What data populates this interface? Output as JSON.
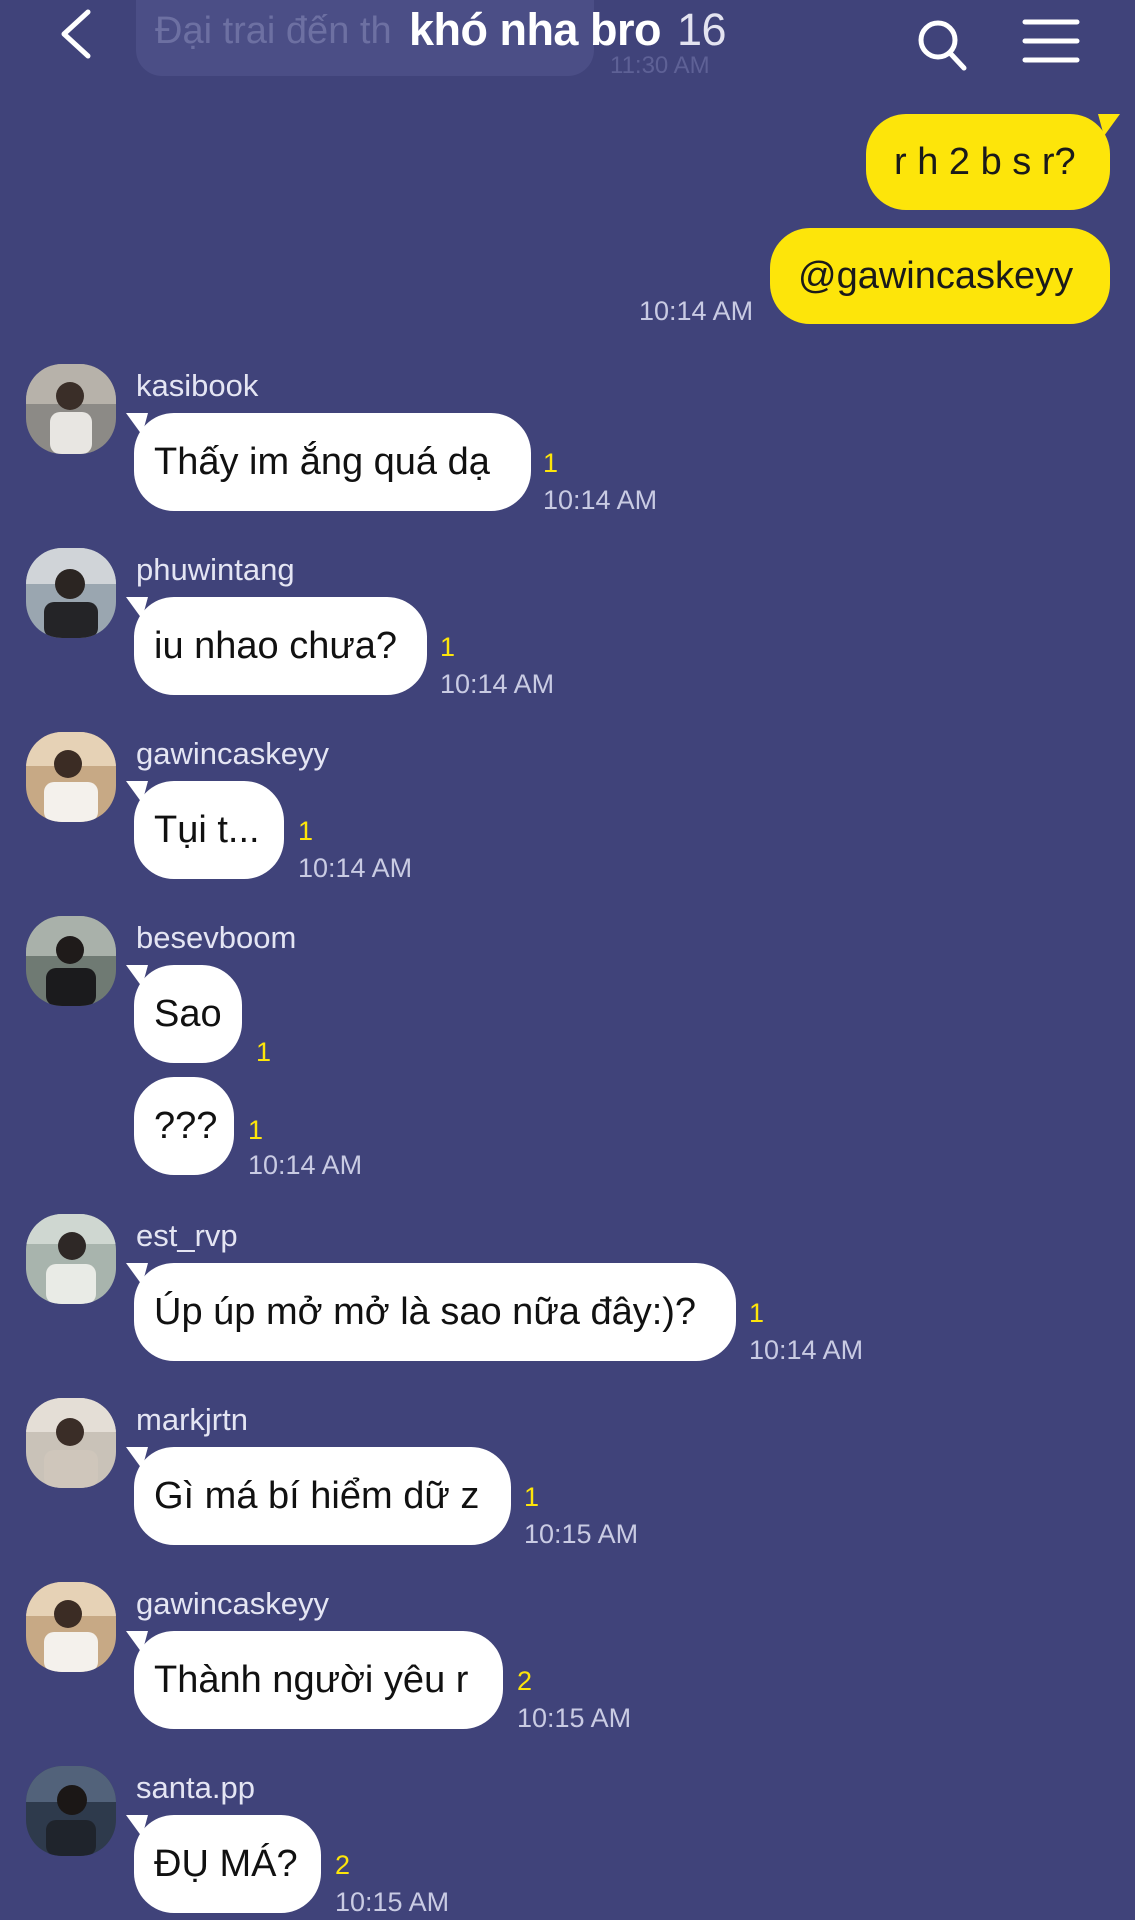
{
  "header": {
    "ghost_preview_text": "Đại trai đến th",
    "ghost_preview_time": "11:30 AM",
    "title": "khó nha bro",
    "member_count": "16"
  },
  "outgoing": [
    {
      "text": "r h 2 b s r?"
    },
    {
      "text": "@gawincaskeyy",
      "time": "10:14 AM"
    }
  ],
  "messages": [
    {
      "user": "kasibook",
      "bubbles": [
        {
          "text": "Thấy im ắng quá dạ",
          "unread": "1",
          "time": "10:14 AM"
        }
      ]
    },
    {
      "user": "phuwintang",
      "bubbles": [
        {
          "text": "iu nhao chưa?",
          "unread": "1",
          "time": "10:14 AM"
        }
      ]
    },
    {
      "user": "gawincaskeyy",
      "bubbles": [
        {
          "text": "Tụi t...",
          "unread": "1",
          "time": "10:14 AM"
        }
      ]
    },
    {
      "user": "besevboom",
      "bubbles": [
        {
          "text": "Sao",
          "unread": "1"
        },
        {
          "text": "???",
          "unread": "1",
          "time": "10:14 AM"
        }
      ]
    },
    {
      "user": "est_rvp",
      "bubbles": [
        {
          "text": "Úp úp mở mở là sao nữa đây:)?",
          "unread": "1",
          "time": "10:14 AM"
        }
      ]
    },
    {
      "user": "markjrtn",
      "bubbles": [
        {
          "text": "Gì má bí hiểm dữ z",
          "unread": "1",
          "time": "10:15 AM"
        }
      ]
    },
    {
      "user": "gawincaskeyy",
      "bubbles": [
        {
          "text": "Thành người yêu r",
          "unread": "2",
          "time": "10:15 AM"
        }
      ]
    },
    {
      "user": "santa.pp",
      "bubbles": [
        {
          "text": "ĐỤ MÁ?",
          "unread": "2",
          "time": "10:15 AM"
        }
      ]
    }
  ],
  "colors": {
    "background": "#40437A",
    "outgoing_bubble": "#FDE50A",
    "incoming_bubble": "#FFFFFF",
    "unread_count": "#FDE50A"
  },
  "icons": {
    "back": "chevron-left-icon",
    "search": "search-icon",
    "menu": "hamburger-menu-icon"
  }
}
